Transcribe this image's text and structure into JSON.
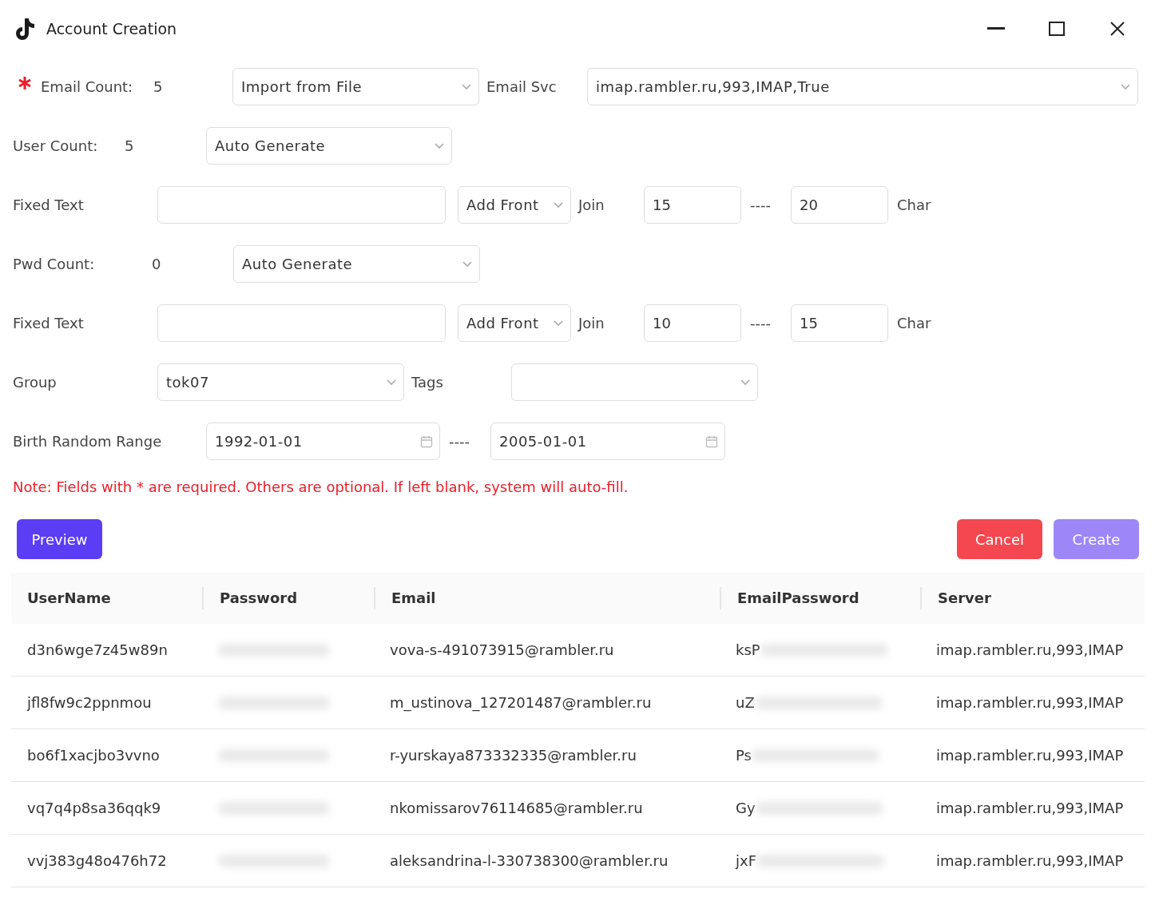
{
  "window": {
    "title": "Account Creation"
  },
  "email_row": {
    "required": true,
    "label": "Email Count:",
    "count": "5",
    "source": "Import from File",
    "svc_label": "Email Svc",
    "svc": "imap.rambler.ru,993,IMAP,True"
  },
  "user_row": {
    "label": "User Count:",
    "count": "5",
    "source": "Auto Generate"
  },
  "user_fixed": {
    "label": "Fixed Text",
    "position": "Add Front",
    "join_label": "Join",
    "min": "15",
    "sep": "----",
    "max": "20",
    "unit": "Char"
  },
  "pwd_row": {
    "label": "Pwd Count:",
    "count": "0",
    "source": "Auto Generate"
  },
  "pwd_fixed": {
    "label": "Fixed Text",
    "position": "Add Front",
    "join_label": "Join",
    "min": "10",
    "sep": "----",
    "max": "15",
    "unit": "Char"
  },
  "group_row": {
    "label": "Group",
    "group": "tok07",
    "tags_label": "Tags"
  },
  "birth_row": {
    "label": "Birth Random Range",
    "from": "1992-01-01",
    "sep": "----",
    "to": "2005-01-01"
  },
  "note": "Note: Fields with * are required. Others are optional. If left blank, system will auto-fill.",
  "buttons": [
    {
      "label": "Preview",
      "kind": "primary",
      "hovered": false
    },
    {
      "label": "Cancel",
      "kind": "danger",
      "hovered": false
    },
    {
      "label": "Create",
      "kind": "primary",
      "hovered": true
    }
  ],
  "table": {
    "columns": [
      "UserName",
      "Password",
      "Email",
      "EmailPassword",
      "Server"
    ],
    "rows": [
      {
        "username": "d3n6wge7z45w89n",
        "email": "vova-s-491073915@rambler.ru",
        "email_password": "ksP",
        "server": "imap.rambler.ru,993,IMAP"
      },
      {
        "username": "jfl8fw9c2ppnmou",
        "email": "m_ustinova_127201487@rambler.ru",
        "email_password": "uZ",
        "server": "imap.rambler.ru,993,IMAP"
      },
      {
        "username": "bo6f1xacjbo3vvno",
        "email": "r-yurskaya873332335@rambler.ru",
        "email_password": "Ps",
        "server": "imap.rambler.ru,993,IMAP"
      },
      {
        "username": "vq7q4p8sa36qqk9",
        "email": "nkomissarov76114685@rambler.ru",
        "email_password": "Gy",
        "server": "imap.rambler.ru,993,IMAP"
      },
      {
        "username": "vvj383g48o476h72",
        "email": "aleksandrina-l-330738300@rambler.ru",
        "email_password": "jxF",
        "server": "imap.rambler.ru,993,IMAP"
      }
    ]
  }
}
